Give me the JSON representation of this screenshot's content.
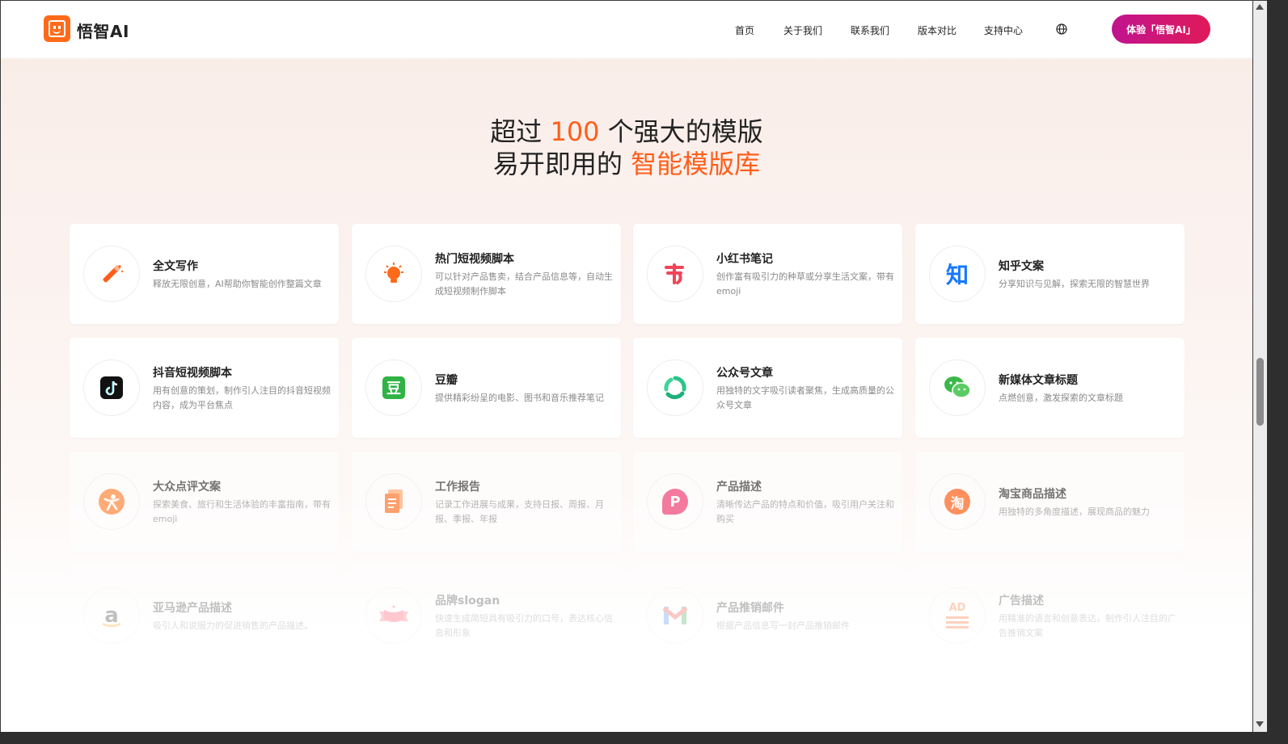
{
  "header": {
    "brand": "悟智AI",
    "nav": [
      "首页",
      "关于我们",
      "联系我们",
      "版本对比",
      "支持中心"
    ],
    "cta": "体验「悟智AI」"
  },
  "hero": {
    "line1_before": "超过 ",
    "line1_accent": "100",
    "line1_after": " 个强大的模版",
    "line2_before": "易开即用的 ",
    "line2_accent": "智能模版库"
  },
  "templates": [
    {
      "title": "全文写作",
      "desc": "释放无限创意，AI帮助你智能创作整篇文章",
      "icon": "magic-wand-icon"
    },
    {
      "title": "热门短视频脚本",
      "desc": "可以针对产品售卖，结合产品信息等，自动生成短视频制作脚本",
      "icon": "lightbulb-icon"
    },
    {
      "title": "小红书笔记",
      "desc": "创作富有吸引力的种草或分享生活文案，带有emoji",
      "icon": "xiaohongshu-icon"
    },
    {
      "title": "知乎文案",
      "desc": "分享知识与见解，探索无限的智慧世界",
      "icon": "zhihu-icon",
      "icon_text": "知"
    },
    {
      "title": "抖音短视频脚本",
      "desc": "用有创意的策划，制作引人注目的抖音短视频内容，成为平台焦点",
      "icon": "douyin-icon"
    },
    {
      "title": "豆瓣",
      "desc": "提供精彩纷呈的电影、图书和音乐推荐笔记",
      "icon": "douban-icon",
      "icon_text": "豆"
    },
    {
      "title": "公众号文章",
      "desc": "用独特的文字吸引读者聚焦，生成高质量的公众号文章",
      "icon": "wechat-official-icon"
    },
    {
      "title": "新媒体文章标题",
      "desc": "点燃创意，激发探索的文章标题",
      "icon": "wechat-icon"
    },
    {
      "title": "大众点评文案",
      "desc": "探索美食、旅行和生活体验的丰富指南，带有emoji",
      "icon": "dianping-icon"
    },
    {
      "title": "工作报告",
      "desc": "记录工作进展与成果，支持日报、周报、月报、季报、年报",
      "icon": "document-icon"
    },
    {
      "title": "产品描述",
      "desc": "清晰传达产品的特点和价值，吸引用户关注和购买",
      "icon": "product-p-icon",
      "icon_text": "P"
    },
    {
      "title": "淘宝商品描述",
      "desc": "用独特的多角度描述，展现商品的魅力",
      "icon": "taobao-icon",
      "icon_text": "淘"
    },
    {
      "title": "亚马逊产品描述",
      "desc": "吸引人和说服力的促进销售的产品描述。",
      "icon": "amazon-icon",
      "icon_text": "a"
    },
    {
      "title": "品牌slogan",
      "desc": "快速生成简短具有吸引力的口号，表达核心信息和形象",
      "icon": "ribbon-icon"
    },
    {
      "title": "产品推销邮件",
      "desc": "根据产品信息写一封产品推销邮件",
      "icon": "gmail-icon"
    },
    {
      "title": "广告描述",
      "desc": "用精准的语言和创意表达，制作引人注目的广告推销文案",
      "icon": "ad-icon",
      "icon_text": "AD"
    }
  ],
  "colors": {
    "accent": "#ff5e1a",
    "cta_gradient_start": "#c0138f",
    "cta_gradient_end": "#e01a59"
  }
}
